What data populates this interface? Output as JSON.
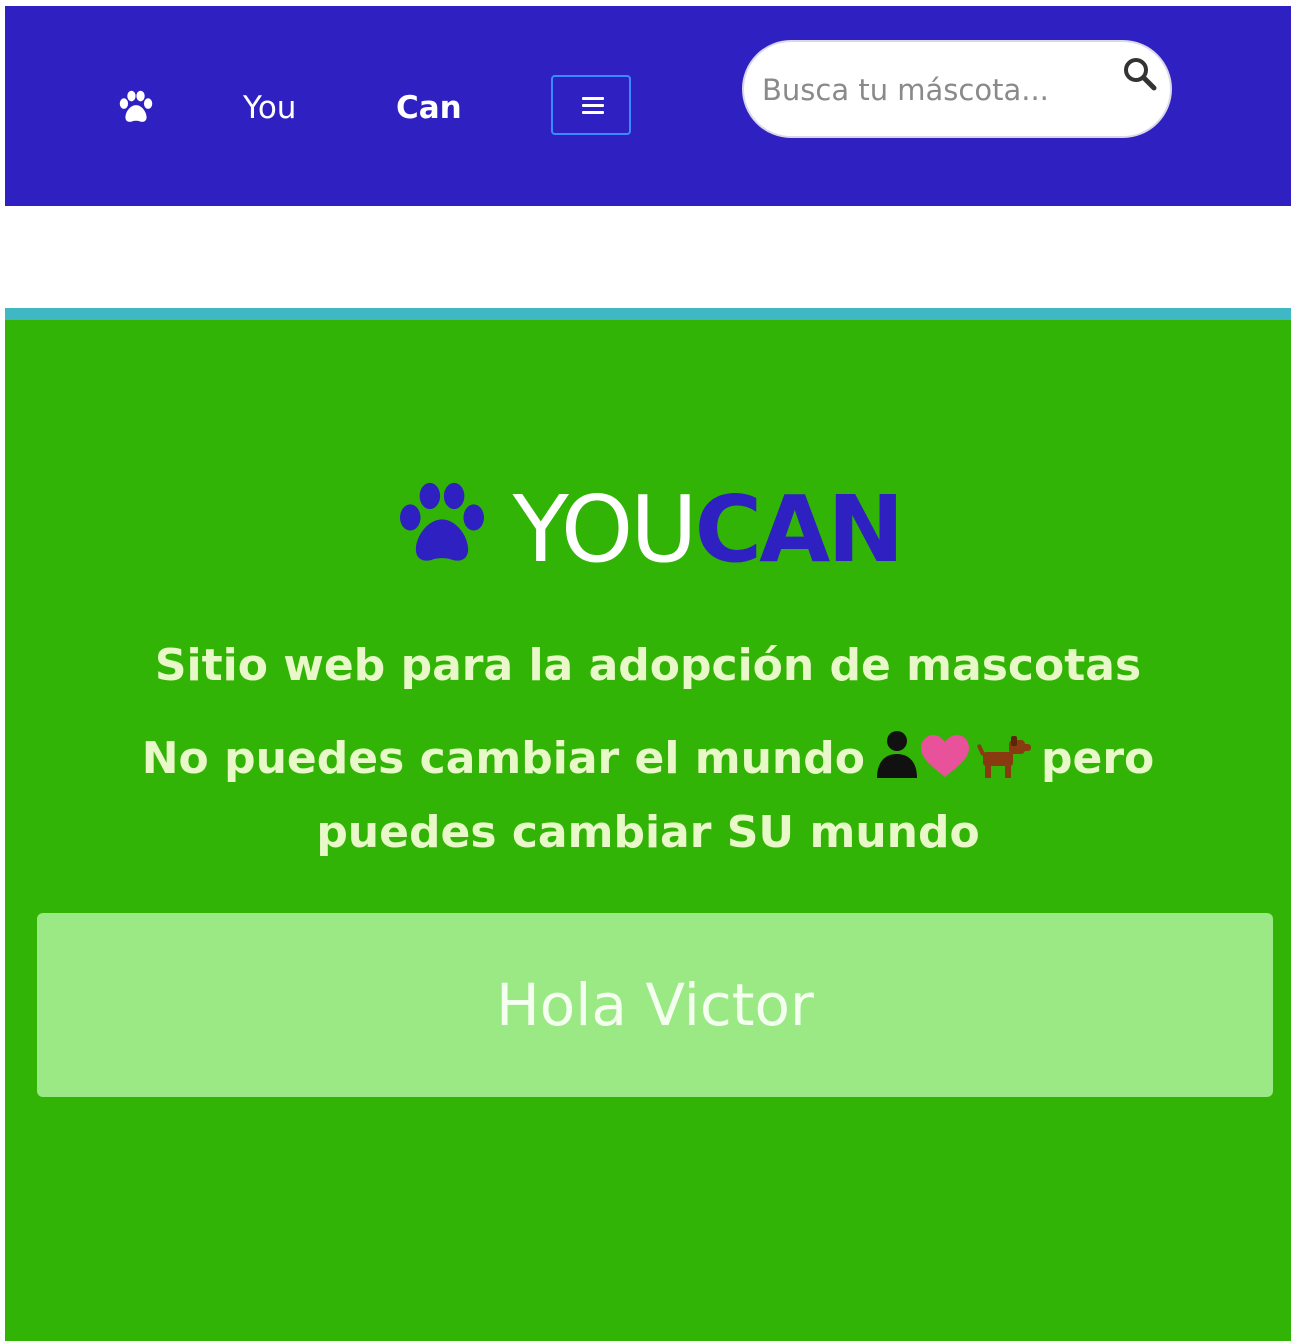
{
  "navbar": {
    "brand_icon": "paw-icon",
    "links": [
      {
        "label": "You"
      },
      {
        "label": "Can"
      }
    ],
    "toggler_icon": "hamburger-icon",
    "search": {
      "placeholder": "Busca tu máscota...",
      "value": "",
      "icon": "search-icon"
    },
    "colors": {
      "background": "#2f21c1",
      "text": "#ffffff"
    }
  },
  "hero": {
    "brand": {
      "icon": "paw-icon",
      "part1": "YOU",
      "part2": "CAN"
    },
    "tagline": "Sitio web para la adopción de mascotas",
    "motto": {
      "before": "No puedes cambiar el mundo",
      "emoji_icons": [
        "person-icon",
        "heart-icon",
        "dog-icon"
      ],
      "after": "pero puedes cambiar SU mundo"
    },
    "greeting": "Hola Victor",
    "colors": {
      "background": "#32b406",
      "accent_line": "#3fb8c4",
      "brand_accent": "#2f21c1",
      "greeting_background": "#9be985"
    }
  }
}
